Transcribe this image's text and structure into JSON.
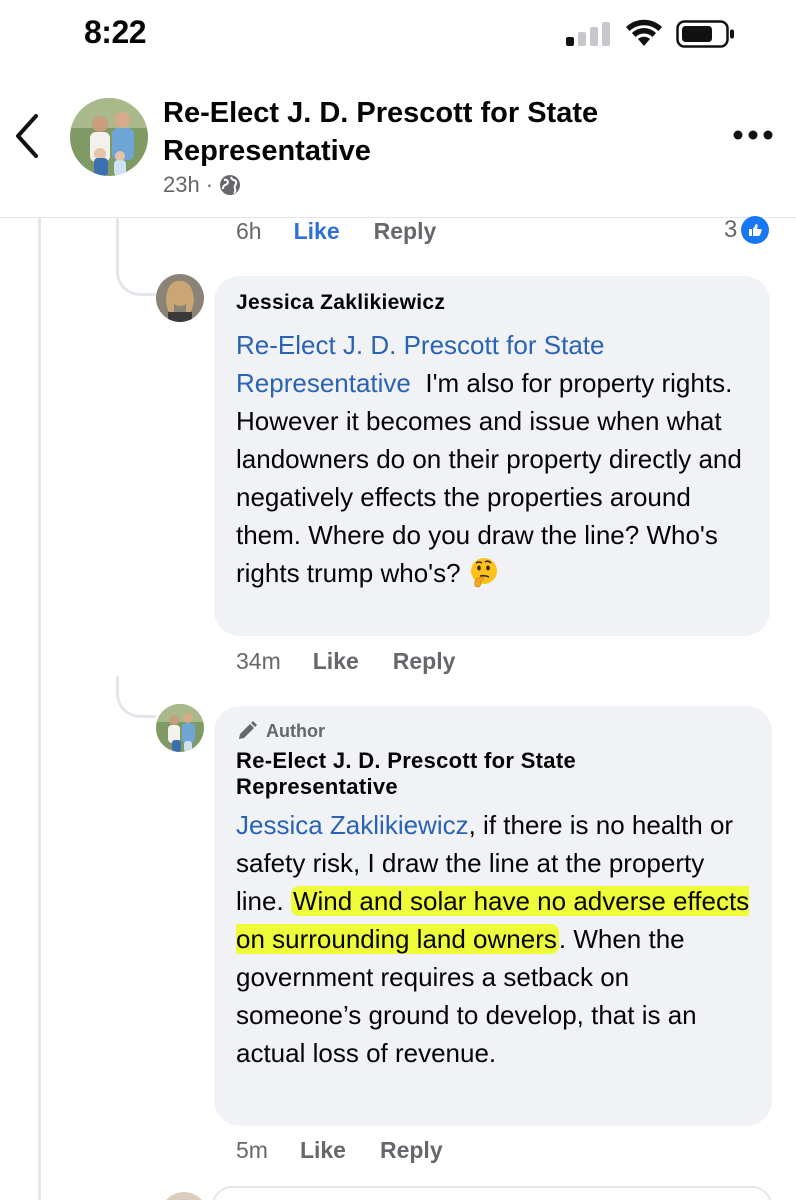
{
  "status_bar": {
    "time": "8:22"
  },
  "header": {
    "page_name": "Re-Elect J. D. Prescott for State Representative",
    "post_time": "23h",
    "audience_icon": "globe-icon",
    "dot": "·"
  },
  "first_actions": {
    "time": "6h",
    "like": "Like",
    "reply": "Reply",
    "reaction_count": "3"
  },
  "comments": [
    {
      "author": "Jessica Zaklikiewicz",
      "mention": "Re-Elect J. D. Prescott for State Representative",
      "text": "I'm also for property rights. However it becomes and issue when what landowners do on their property directly and negatively effects the properties around them. Where do you draw the line? Who's rights trump who's?",
      "emoji": "thinking-face",
      "time": "34m",
      "like": "Like",
      "reply": "Reply"
    },
    {
      "badge": "Author",
      "author": "Re-Elect J. D. Prescott for State Representative",
      "mention": "Jessica Zaklikiewicz",
      "text_before": ", if there is no health or safety risk, I draw the line at the property line.",
      "text_highlight": "Wind and solar have no adverse effects on surrounding land owners",
      "text_after": ". When the government requires a setback on someone’s ground to develop, that is an actual loss of revenue.",
      "time": "5m",
      "like": "Like",
      "reply": "Reply"
    }
  ],
  "colors": {
    "link_blue": "#2a63b3",
    "like_blue": "#2e6fd8",
    "bubble_bg": "#f0f2f5",
    "highlight": "#eefc3a"
  }
}
